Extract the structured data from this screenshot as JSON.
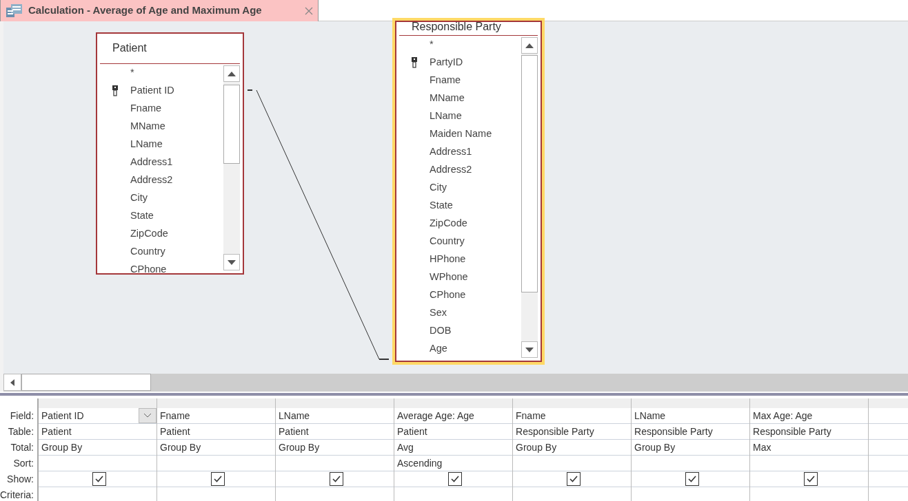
{
  "tab": {
    "title": "Calculation - Average of Age and Maximum Age",
    "selected": true
  },
  "tables": [
    {
      "title": "Patient",
      "highlighted": false,
      "fields": [
        {
          "name": "*",
          "key": false
        },
        {
          "name": "Patient ID",
          "key": true
        },
        {
          "name": "Fname",
          "key": false
        },
        {
          "name": "MName",
          "key": false
        },
        {
          "name": "LName",
          "key": false
        },
        {
          "name": "Address1",
          "key": false
        },
        {
          "name": "Address2",
          "key": false
        },
        {
          "name": "City",
          "key": false
        },
        {
          "name": "State",
          "key": false
        },
        {
          "name": "ZipCode",
          "key": false
        },
        {
          "name": "Country",
          "key": false
        },
        {
          "name": "CPhone",
          "key": false
        }
      ]
    },
    {
      "title": "Responsible Party",
      "highlighted": true,
      "fields": [
        {
          "name": "*",
          "key": false
        },
        {
          "name": "PartyID",
          "key": true
        },
        {
          "name": "Fname",
          "key": false
        },
        {
          "name": "MName",
          "key": false
        },
        {
          "name": "LName",
          "key": false
        },
        {
          "name": "Maiden Name",
          "key": false
        },
        {
          "name": "Address1",
          "key": false
        },
        {
          "name": "Address2",
          "key": false
        },
        {
          "name": "City",
          "key": false
        },
        {
          "name": "State",
          "key": false
        },
        {
          "name": "ZipCode",
          "key": false
        },
        {
          "name": "Country",
          "key": false
        },
        {
          "name": "HPhone",
          "key": false
        },
        {
          "name": "WPhone",
          "key": false
        },
        {
          "name": "CPhone",
          "key": false
        },
        {
          "name": "Sex",
          "key": false
        },
        {
          "name": "DOB",
          "key": false
        },
        {
          "name": "Age",
          "key": false
        }
      ]
    }
  ],
  "grid": {
    "row_labels": [
      "Field:",
      "Table:",
      "Total:",
      "Sort:",
      "Show:",
      "Criteria:"
    ],
    "columns": [
      {
        "field": "Patient ID",
        "table": "Patient",
        "total": "Group By",
        "show": true,
        "selected": true
      },
      {
        "field": "Fname",
        "table": "Patient",
        "total": "Group By",
        "show": true,
        "selected": false
      },
      {
        "field": "LName",
        "table": "Patient",
        "total": "Group By",
        "show": true,
        "selected": false
      },
      {
        "field": "Average Age: Age",
        "table": "Patient",
        "total": "Avg",
        "sort": "Ascending",
        "show": true,
        "selected": false
      },
      {
        "field": "Fname",
        "table": "Responsible Party",
        "total": "Group By",
        "show": true,
        "selected": false
      },
      {
        "field": "LName",
        "table": "Responsible Party",
        "total": "Group By",
        "show": true,
        "selected": false
      },
      {
        "field": "Max Age: Age",
        "table": "Responsible Party",
        "total": "Max",
        "show": true,
        "selected": false
      }
    ]
  }
}
